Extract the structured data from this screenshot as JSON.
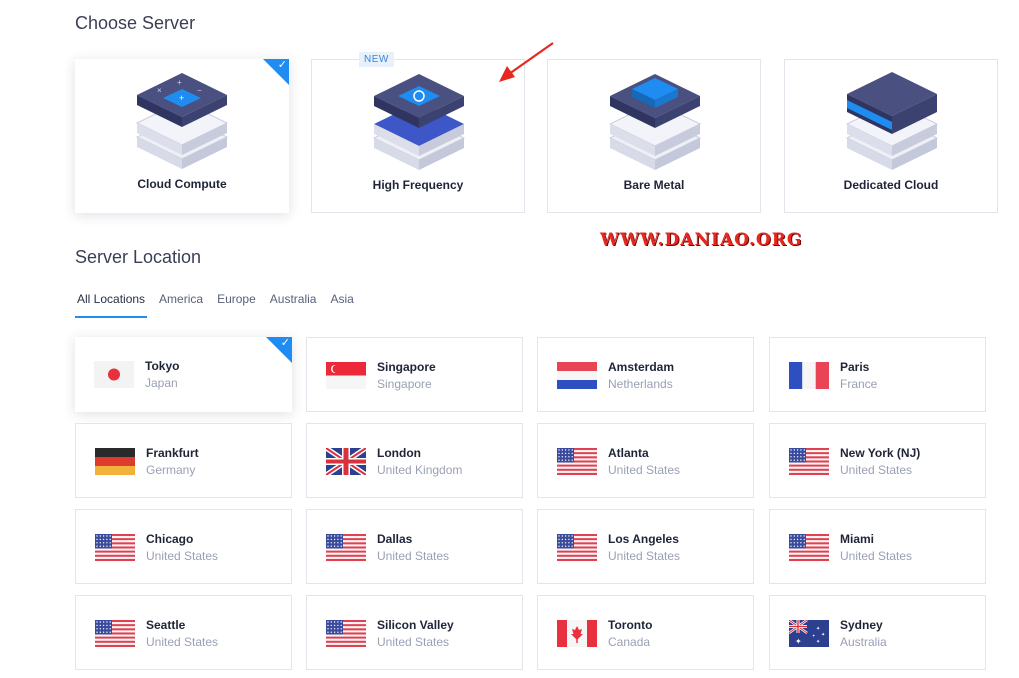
{
  "choose_server": {
    "title": "Choose Server",
    "new_badge": "NEW",
    "cards": [
      {
        "label": "Cloud Compute",
        "icon": "cloud-compute-icon",
        "selected": true
      },
      {
        "label": "High Frequency",
        "icon": "high-frequency-icon",
        "selected": false
      },
      {
        "label": "Bare Metal",
        "icon": "bare-metal-icon",
        "selected": false
      },
      {
        "label": "Dedicated Cloud",
        "icon": "dedicated-cloud-icon",
        "selected": false
      }
    ]
  },
  "watermark": "WWW.DANIAO.ORG",
  "server_location": {
    "title": "Server Location",
    "tabs": [
      "All Locations",
      "America",
      "Europe",
      "Australia",
      "Asia"
    ],
    "active_tab": "All Locations",
    "locations": [
      {
        "city": "Tokyo",
        "country": "Japan",
        "flag": "jp",
        "selected": true
      },
      {
        "city": "Singapore",
        "country": "Singapore",
        "flag": "sg"
      },
      {
        "city": "Amsterdam",
        "country": "Netherlands",
        "flag": "nl"
      },
      {
        "city": "Paris",
        "country": "France",
        "flag": "fr"
      },
      {
        "city": "Frankfurt",
        "country": "Germany",
        "flag": "de"
      },
      {
        "city": "London",
        "country": "United Kingdom",
        "flag": "gb"
      },
      {
        "city": "Atlanta",
        "country": "United States",
        "flag": "us"
      },
      {
        "city": "New York (NJ)",
        "country": "United States",
        "flag": "us"
      },
      {
        "city": "Chicago",
        "country": "United States",
        "flag": "us"
      },
      {
        "city": "Dallas",
        "country": "United States",
        "flag": "us"
      },
      {
        "city": "Los Angeles",
        "country": "United States",
        "flag": "us"
      },
      {
        "city": "Miami",
        "country": "United States",
        "flag": "us"
      },
      {
        "city": "Seattle",
        "country": "United States",
        "flag": "us"
      },
      {
        "city": "Silicon Valley",
        "country": "United States",
        "flag": "us"
      },
      {
        "city": "Toronto",
        "country": "Canada",
        "flag": "ca"
      },
      {
        "city": "Sydney",
        "country": "Australia",
        "flag": "au"
      }
    ]
  },
  "colors": {
    "accent": "#1e8cf0",
    "annotation_red": "#e8271f"
  }
}
